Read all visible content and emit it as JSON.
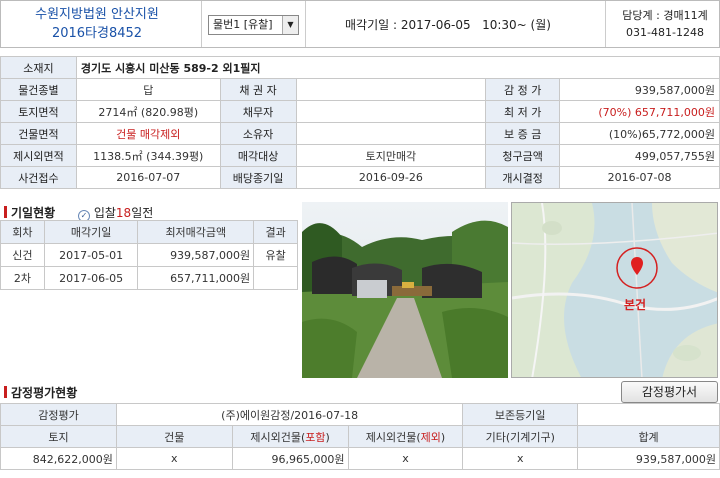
{
  "header": {
    "court": "수원지방법원 안산지원",
    "case_no": "2016타경8452",
    "item_select": "물번1 [유찰]",
    "sale_date_label": "매각기일 :",
    "sale_date": "2017-06-05",
    "sale_time": "10:30~ (월)",
    "dept": "담당계 : 경매11계",
    "phone": "031-481-1248"
  },
  "info": {
    "address_label": "소재지",
    "address": "경기도 시흥시 미산동 589-2 외1필지",
    "rows": [
      [
        "물건종별",
        "답",
        "채 권 자",
        "",
        "감 정 가",
        "939,587,000원"
      ],
      [
        "토지면적",
        "2714㎡ (820.98평)",
        "채무자",
        "",
        "최 저 가",
        "(70%) 657,711,000원"
      ],
      [
        "건물면적",
        "건물 매각제외",
        "소유자",
        "",
        "보 증 금",
        "(10%)65,772,000원"
      ],
      [
        "제시외면적",
        "1138.5㎡ (344.39평)",
        "매각대상",
        "토지만매각",
        "청구금액",
        "499,057,755원"
      ],
      [
        "사건접수",
        "2016-07-07",
        "배당종기일",
        "2016-09-26",
        "개시결정",
        "2016-07-08"
      ]
    ]
  },
  "history": {
    "title": "기일현황",
    "badge_prefix": "입찰",
    "badge_days": "18",
    "badge_suffix": "일전",
    "headers": [
      "회차",
      "매각기일",
      "최저매각금액",
      "결과"
    ],
    "rows": [
      [
        "신건",
        "2017-05-01",
        "939,587,000원",
        "유찰"
      ],
      [
        "2차",
        "2017-06-05",
        "657,711,000원",
        ""
      ]
    ]
  },
  "map": {
    "marker_label": "본건"
  },
  "appraisal": {
    "title": "감정평가현황",
    "button": "감정평가서",
    "label1": "감정평가",
    "appraiser": "(주)에이원감정/2016-07-18",
    "label2": "보존등기일",
    "registration_date": "",
    "headers": [
      "토지",
      "건물",
      "제시외건물(",
      "포함",
      ")",
      "제시외건물(",
      "제외",
      ")",
      "기타(기계기구)",
      "합계"
    ],
    "values": [
      "842,622,000원",
      "x",
      "96,965,000원",
      "x",
      "x",
      "939,587,000원"
    ]
  },
  "colors": {
    "accent_blue": "#1a52a8",
    "accent_red": "#c81e1e",
    "header_bg": "#e8eef6"
  }
}
